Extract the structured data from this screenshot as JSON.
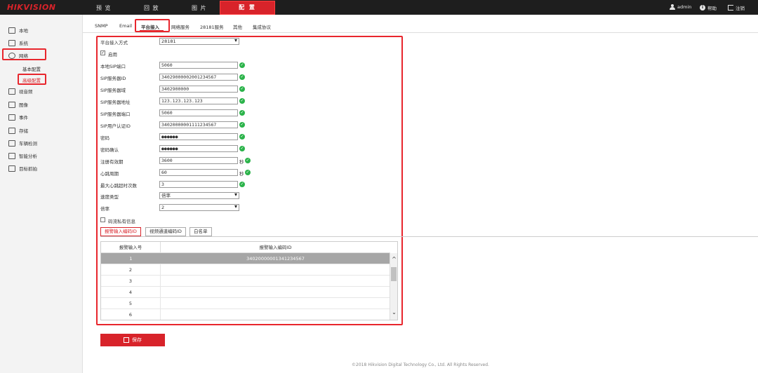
{
  "brand": "HIKVISION",
  "nav": {
    "preview": "预 览",
    "playback": "回 放",
    "picture": "图 片",
    "config": "配 置"
  },
  "user": {
    "name": "admin",
    "help": "帮助",
    "logout": "注销"
  },
  "sidebar": {
    "local": "本地",
    "system": "系统",
    "network": "网络",
    "basic": "基本配置",
    "advanced": "高级配置",
    "video_audio": "视音频",
    "image": "图像",
    "event": "事件",
    "storage": "存储",
    "vehicle": "车辆检测",
    "smart": "智能分析",
    "target": "目标抓拍"
  },
  "tabs": [
    "SNMP",
    "Email",
    "平台接入",
    "网络服务",
    "28181服务",
    "其他",
    "集成协议"
  ],
  "form": {
    "access_mode_label": "平台接入方式",
    "access_mode_value": "28181",
    "enable_label": "启用",
    "local_sip_port_label": "本地SIP端口",
    "local_sip_port": "5060",
    "sip_server_id_label": "SIP服务器ID",
    "sip_server_id": "34029000002001234567",
    "sip_server_domain_label": "SIP服务器域",
    "sip_server_domain": "3402900000",
    "sip_server_addr_label": "SIP服务器地址",
    "sip_server_addr": "123.123.123.123",
    "sip_server_port_label": "SIP服务器端口",
    "sip_server_port": "5060",
    "sip_user_id_label": "SIP用户认证ID",
    "sip_user_id": "34020000001111234567",
    "password_label": "密码",
    "password": "●●●●●●",
    "password_confirm_label": "密码确认",
    "password_confirm": "●●●●●●",
    "reg_validity_label": "注册有效期",
    "reg_validity": "3600",
    "reg_unit": "秒",
    "heartbeat_label": "心跳周期",
    "heartbeat": "60",
    "heartbeat_unit": "秒",
    "max_timeout_label": "最大心跳超时次数",
    "max_timeout": "3",
    "stream_type_label": "速度类型",
    "stream_type": "倍率",
    "rate_label": "倍率",
    "rate": "2",
    "private_signal_label": "码流私有信息"
  },
  "subtabs": [
    "报警输入编码ID",
    "视频通道编码ID",
    "白名单"
  ],
  "table": {
    "col1": "报警输入号",
    "col2": "报警输入编码ID",
    "rows": [
      {
        "num": "1",
        "id": "34020000001341234567"
      },
      {
        "num": "2",
        "id": ""
      },
      {
        "num": "3",
        "id": ""
      },
      {
        "num": "4",
        "id": ""
      },
      {
        "num": "5",
        "id": ""
      },
      {
        "num": "6",
        "id": ""
      }
    ]
  },
  "save_label": "保存",
  "footer": "©2018 Hikvision Digital Technology Co., Ltd. All Rights Reserved.",
  "colors": {
    "accent": "#d8232a",
    "ok": "#2bb34a",
    "topbar": "#1e1e1e"
  }
}
